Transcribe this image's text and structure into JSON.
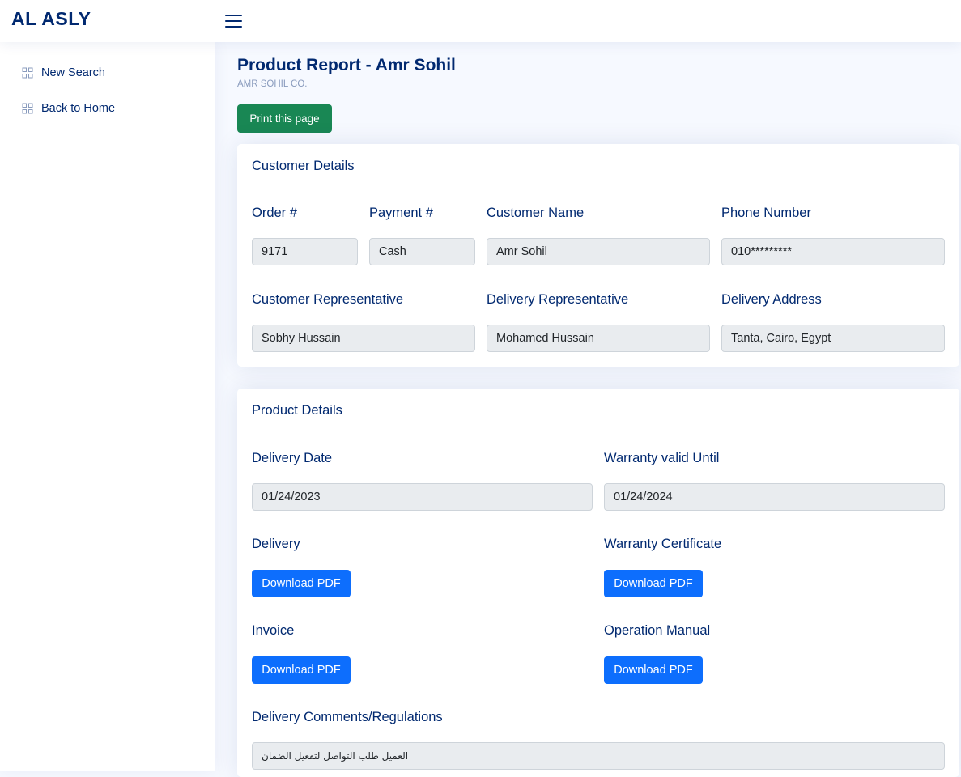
{
  "header": {
    "logo": "AL ASLY"
  },
  "sidebar": {
    "items": [
      {
        "label": "New Search",
        "icon": "grid-icon"
      },
      {
        "label": "Back to Home",
        "icon": "grid-icon"
      }
    ]
  },
  "page": {
    "title": "Product Report - Amr Sohil",
    "subtitle": "AMR SOHIL CO.",
    "print_label": "Print this page"
  },
  "customer": {
    "title": "Customer Details",
    "order_label": "Order #",
    "order_value": "9171",
    "payment_label": "Payment #",
    "payment_value": "Cash",
    "name_label": "Customer Name",
    "name_value": "Amr Sohil",
    "phone_label": "Phone Number",
    "phone_value": "010*********",
    "rep_label": "Customer Representative",
    "rep_value": "Sobhy Hussain",
    "delivery_rep_label": "Delivery Representative",
    "delivery_rep_value": "Mohamed Hussain",
    "address_label": "Delivery Address",
    "address_value": "Tanta, Cairo, Egypt"
  },
  "product": {
    "title": "Product Details",
    "delivery_date_label": "Delivery Date",
    "delivery_date_value": "01/24/2023",
    "warranty_label": "Warranty valid Until",
    "warranty_value": "01/24/2024",
    "delivery_label": "Delivery",
    "certificate_label": "Warranty Certificate",
    "invoice_label": "Invoice",
    "manual_label": "Operation Manual",
    "download_label": "Download PDF",
    "comments_label": "Delivery Comments/Regulations",
    "comments_value": "العميل طلب التواصل لتفعيل الضمان"
  },
  "colors": {
    "primary": "#012970",
    "success": "#198754",
    "button": "#0d6efd",
    "field_bg": "#e9ecef"
  }
}
